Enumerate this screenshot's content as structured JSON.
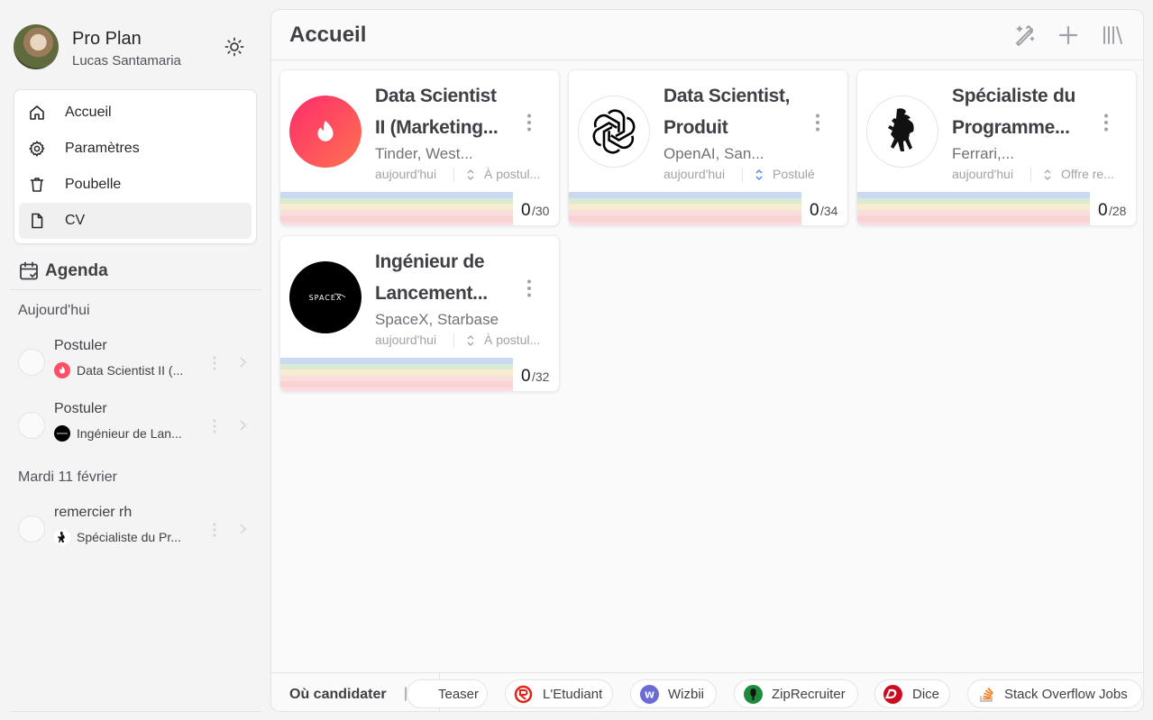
{
  "profile": {
    "plan": "Pro Plan",
    "user": "Lucas Santamaria"
  },
  "nav": {
    "items": [
      {
        "label": "Accueil",
        "icon": "home-icon"
      },
      {
        "label": "Paramètres",
        "icon": "gear-icon"
      },
      {
        "label": "Poubelle",
        "icon": "trash-icon"
      },
      {
        "label": "CV",
        "icon": "document-icon",
        "active": true
      }
    ]
  },
  "agenda": {
    "title": "Agenda",
    "groups": [
      {
        "day": "Aujourd'hui",
        "tasks": [
          {
            "title": "Postuler",
            "job": "Data Scientist II (..."
          },
          {
            "title": "Postuler",
            "job": "Ingénieur de Lan..."
          }
        ]
      },
      {
        "day": "Mardi 11 février",
        "tasks": [
          {
            "title": "remercier rh",
            "job": "Spécialiste du Pr..."
          }
        ]
      }
    ]
  },
  "main": {
    "title": "Accueil"
  },
  "jobs": [
    {
      "title_line1": "Data Scientist",
      "title_line2": "II (Marketing...",
      "company": "Tinder, West...",
      "date": "aujourd'hui",
      "status": "À postul...",
      "score": "0",
      "total": "/30",
      "logo": "tinder-logo-icon"
    },
    {
      "title_line1": "Data Scientist,",
      "title_line2": "Produit",
      "company": "OpenAI, San...",
      "date": "aujourd'hui",
      "status": "Postulé",
      "score": "0",
      "total": "/34",
      "logo": "openai-logo-icon"
    },
    {
      "title_line1": "Spécialiste du",
      "title_line2": "Programme...",
      "company": "Ferrari,...",
      "date": "aujourd'hui",
      "status": "Offre re...",
      "score": "0",
      "total": "/28",
      "logo": "ferrari-logo-icon"
    },
    {
      "title_line1": "Ingénieur de",
      "title_line2": "Lancement...",
      "company": "SpaceX, Starbase",
      "date": "aujourd'hui",
      "status": "À postul...",
      "score": "0",
      "total": "/32",
      "logo": "spacex-logo-icon",
      "logo_text": "SPACEX"
    }
  ],
  "job_boards": {
    "label": "Où candidater",
    "items": [
      "Teaser",
      "L'Etudiant",
      "Wizbii",
      "ZipRecruiter",
      "Dice",
      "Stack Overflow Jobs"
    ],
    "wizbii_mark": "W"
  },
  "colors": {
    "tinder": "#fd5068",
    "status_applied": "#3b82f6",
    "bands": [
      "#c9d9f2",
      "#d9ead3",
      "#f7ecd0",
      "#f9dede",
      "#f8d3d3",
      "#fcdcdc"
    ]
  }
}
